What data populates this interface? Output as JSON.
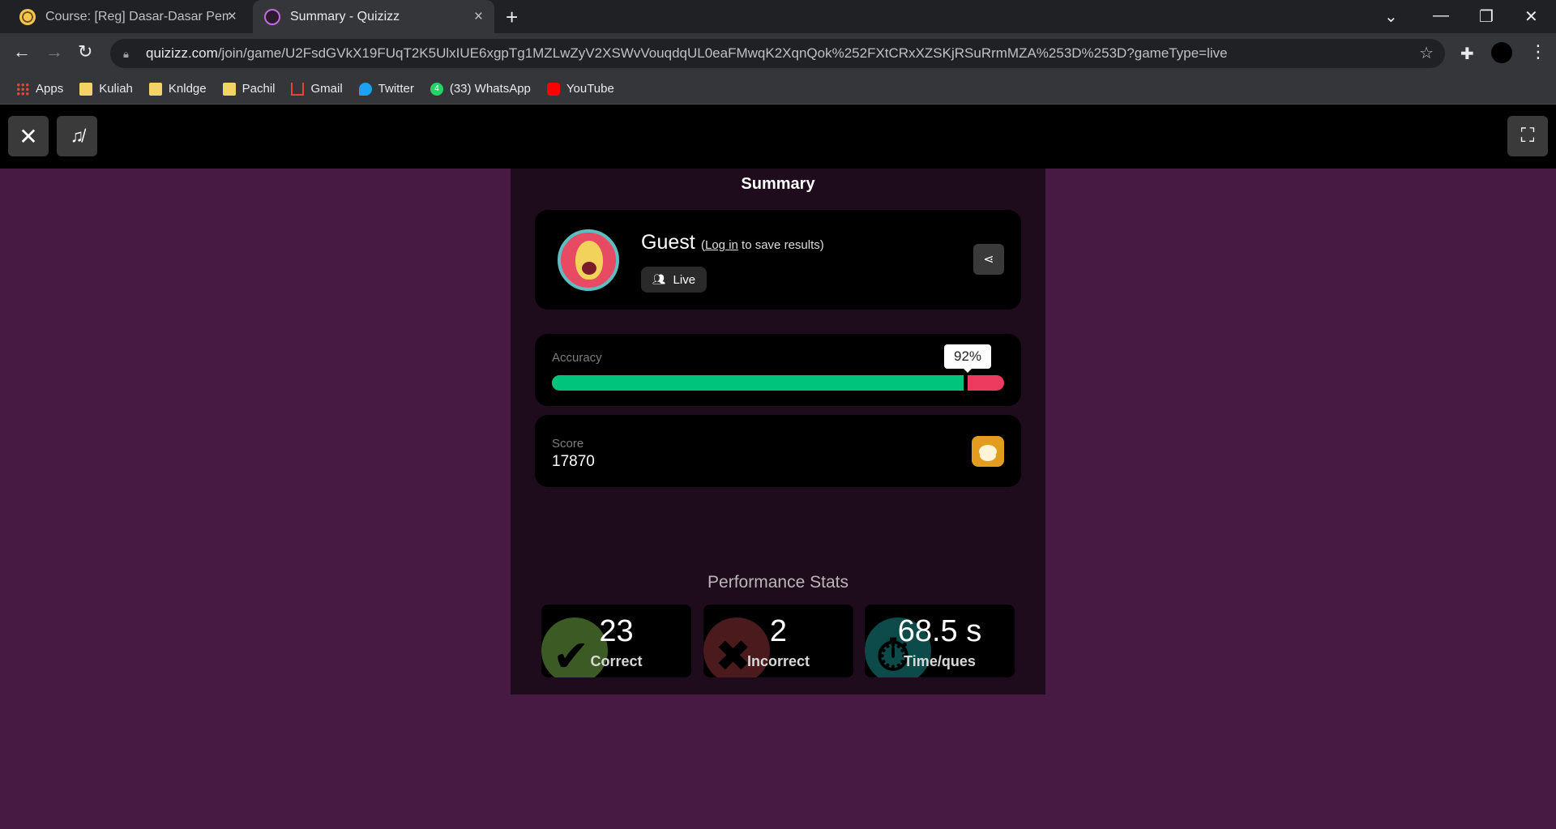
{
  "browser": {
    "tabs": [
      {
        "title": "Course: [Reg] Dasar-Dasar Pemrog",
        "close_icon": "×"
      },
      {
        "title": "Summary - Quizizz",
        "close_icon": "×"
      }
    ],
    "new_tab_icon": "+",
    "url_host": "quizizz.com",
    "url_path": "/join/game/U2FsdGVkX19FUqT2K5UlxIUE6xgpTg1MZLwZyV2XSWvVouqdqUL0eaFMwqK2XqnQok%252FXtCRxXZSKjRSuRrmMZA%253D%253D?gameType=live",
    "bookmarks": [
      {
        "label": "Apps",
        "icon": "apps-grid"
      },
      {
        "label": "Kuliah",
        "icon": "folder"
      },
      {
        "label": "Knldge",
        "icon": "folder"
      },
      {
        "label": "Pachil",
        "icon": "folder"
      },
      {
        "label": "Gmail",
        "icon": "gmail"
      },
      {
        "label": "Twitter",
        "icon": "twitter"
      },
      {
        "label": "(33) WhatsApp",
        "icon": "whatsapp",
        "badge": "4"
      },
      {
        "label": "YouTube",
        "icon": "youtube"
      }
    ]
  },
  "summary": {
    "title": "Summary",
    "player": {
      "name": "Guest",
      "note_open": "(",
      "login_link": "Log in",
      "note_rest": " to save results)",
      "mode": "Live"
    },
    "accuracy": {
      "label": "Accuracy",
      "percent": 92,
      "percent_label": "92%"
    },
    "score": {
      "label": "Score",
      "value": "17870"
    },
    "performance": {
      "title": "Performance Stats",
      "stats": [
        {
          "value": "23",
          "label": "Correct",
          "color": "#3b5a24",
          "icon": "check-icon"
        },
        {
          "value": "2",
          "label": "Incorrect",
          "color": "#4a1a1d",
          "icon": "cross-icon"
        },
        {
          "value": "68.5 s",
          "label": "Time/ques",
          "color": "#0d4a4a",
          "icon": "stopwatch-icon"
        }
      ]
    }
  },
  "colors": {
    "accent_correct": "#00c37c",
    "accent_incorrect": "#ec3b5e",
    "page_bg": "#461a42",
    "panel_bg": "#1e0b1c"
  }
}
